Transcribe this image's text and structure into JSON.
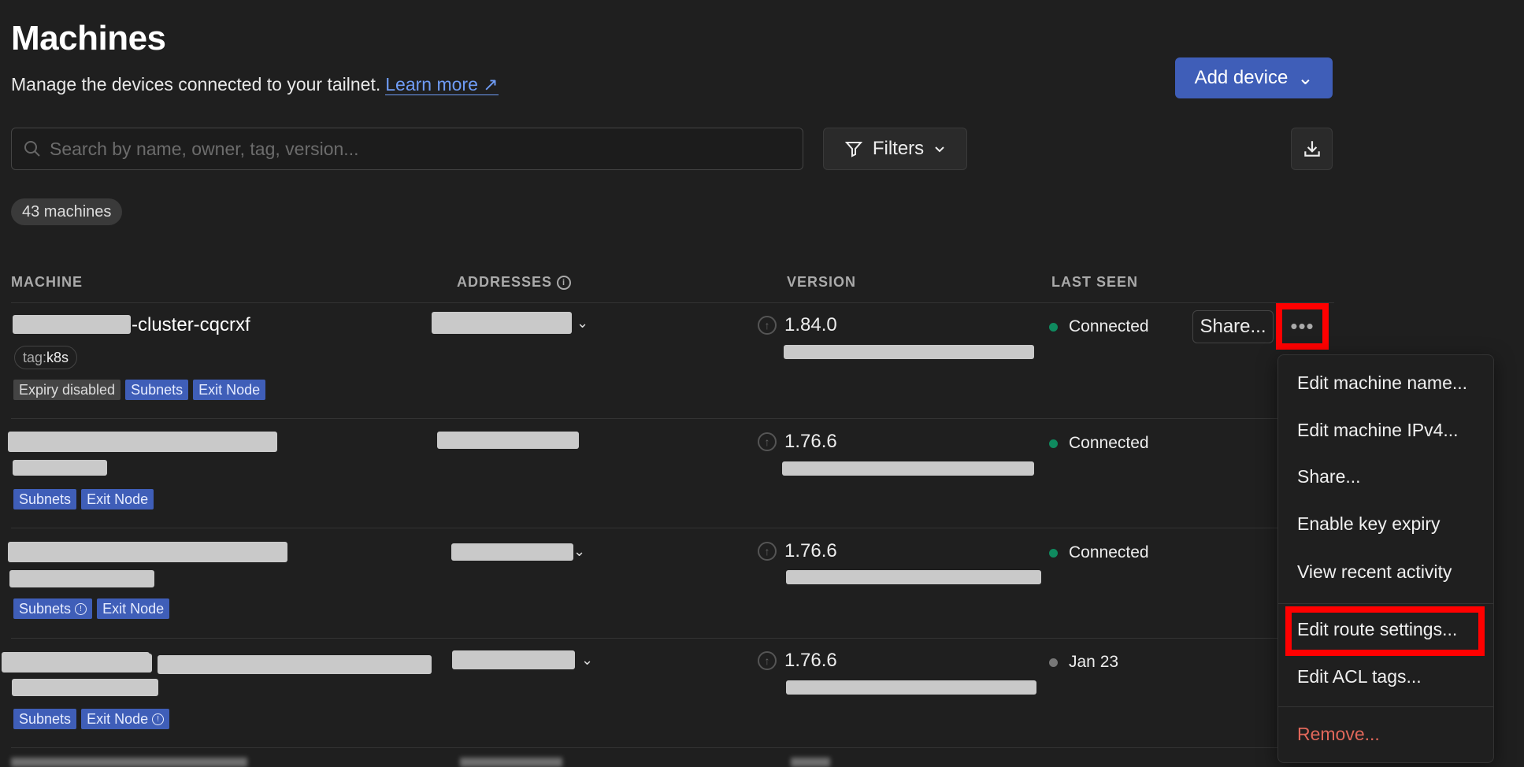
{
  "header": {
    "title": "Machines",
    "subtitle": "Manage the devices connected to your tailnet.",
    "learn_more": "Learn more ↗",
    "add_device": "Add device"
  },
  "search": {
    "placeholder": "Search by name, owner, tag, version..."
  },
  "filters_label": "Filters",
  "machine_count": "43 machines",
  "columns": {
    "machine": "MACHINE",
    "addresses": "ADDRESSES",
    "version": "VERSION",
    "last_seen": "LAST SEEN"
  },
  "rows": [
    {
      "name_suffix": "-cluster-cqcrxf",
      "tag_prefix": "tag:",
      "tag_value": "k8s",
      "badges": [
        "Expiry disabled",
        "Subnets",
        "Exit Node"
      ],
      "version": "1.84.0",
      "status": "Connected"
    },
    {
      "badges": [
        "Subnets",
        "Exit Node"
      ],
      "version": "1.76.6",
      "status": "Connected"
    },
    {
      "badges": [
        "Subnets",
        "Exit Node"
      ],
      "version": "1.76.6",
      "status": "Connected"
    },
    {
      "badges": [
        "Subnets",
        "Exit Node"
      ],
      "version": "1.76.6",
      "status": "Jan 23"
    }
  ],
  "row_actions": {
    "share": "Share..."
  },
  "menu": {
    "items": [
      "Edit machine name...",
      "Edit machine IPv4...",
      "Share...",
      "Enable key expiry",
      "View recent activity",
      "Edit route settings...",
      "Edit ACL tags...",
      "Remove..."
    ]
  },
  "colors": {
    "accent": "#3f5eb8",
    "connected": "#0f8a5f",
    "offline": "#777777",
    "danger": "#e0675a",
    "highlight": "#ff0000"
  }
}
